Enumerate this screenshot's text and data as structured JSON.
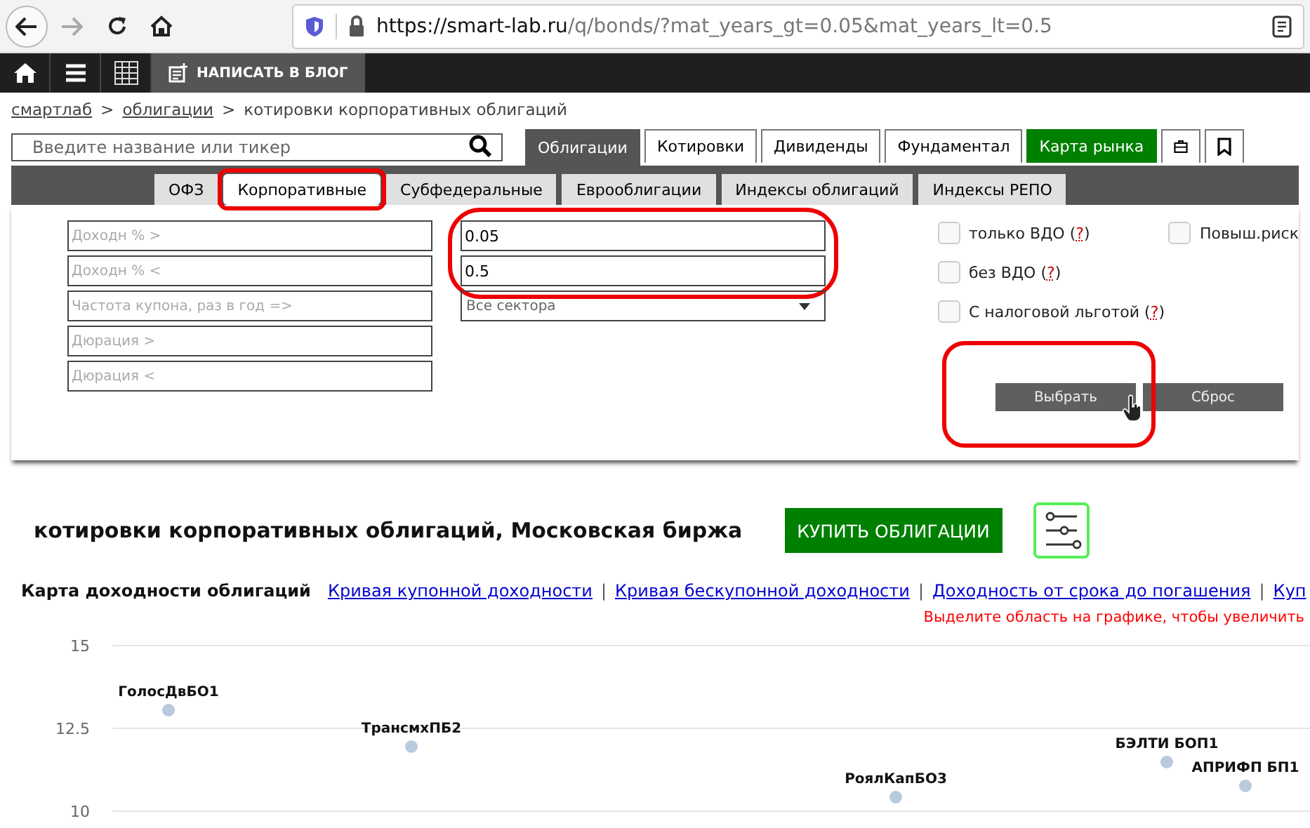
{
  "browser": {
    "url_host": "https://smart-lab.ru",
    "url_path": "/q/bonds/?mat_years_gt=0.05&mat_years_lt=0.5",
    "forward_disabled": true
  },
  "topnav": {
    "write_label": "НАПИСАТЬ В БЛОГ"
  },
  "breadcrumbs": {
    "links": [
      "смартлаб",
      "облигации"
    ],
    "separator": ">",
    "current": "котировки корпоративных облигаций"
  },
  "search": {
    "placeholder": "Введите название или тикер"
  },
  "tabs": [
    {
      "label": "Облигации",
      "kind": "text",
      "selected": true
    },
    {
      "label": "Котировки",
      "kind": "text",
      "selected": false
    },
    {
      "label": "Дивиденды",
      "kind": "text",
      "selected": false
    },
    {
      "label": "Фундаментал",
      "kind": "text",
      "selected": false
    },
    {
      "label": "Карта рынка",
      "kind": "accent",
      "selected": false
    },
    {
      "kind": "briefcase",
      "selected": false
    },
    {
      "kind": "bookmark",
      "selected": false
    }
  ],
  "subtabs": [
    {
      "label": "ОФЗ",
      "selected": false,
      "highlighted": false
    },
    {
      "label": "Корпоративные",
      "selected": true,
      "highlighted": true
    },
    {
      "label": "Субфедеральные",
      "selected": false,
      "highlighted": false
    },
    {
      "label": "Еврооблигации",
      "selected": false,
      "highlighted": false
    },
    {
      "label": "Индексы облигаций",
      "selected": false,
      "highlighted": false
    },
    {
      "label": "Индексы РЕПО",
      "selected": false,
      "highlighted": false
    }
  ],
  "filters": {
    "left_fields": [
      {
        "placeholder": "Доходн % >"
      },
      {
        "placeholder": "Доходн % <"
      },
      {
        "placeholder": "Частота купона, раз в год =>"
      },
      {
        "placeholder": "Дюрация >"
      },
      {
        "placeholder": "Дюрация <"
      }
    ],
    "maturity_fields": [
      {
        "value": "0.05"
      },
      {
        "value": "0.5"
      }
    ],
    "maturity_highlighted": true,
    "sector": {
      "value": "Все сектора"
    },
    "checkboxes": [
      {
        "label_before": "только ВДО (",
        "help": "?",
        "label_after": ")",
        "checked": false
      },
      {
        "label_before": "без ВДО (",
        "help": "?",
        "label_after": ")",
        "checked": false
      },
      {
        "label_before": "С налоговой льготой (",
        "help": "?",
        "label_after": ")",
        "checked": false
      }
    ],
    "extra_checkbox": {
      "label": "Повыш.риск",
      "checked": false
    },
    "select_button": {
      "label": "Выбрать",
      "highlighted": true
    },
    "reset_button": {
      "label": "Сброс"
    }
  },
  "heading": {
    "title": "котировки корпоративных облигаций, Московская биржа",
    "buy_button": "КУПИТЬ ОБЛИГАЦИИ"
  },
  "chart_links": {
    "current": "Карта доходности облигаций",
    "links": [
      "Кривая купонной доходности",
      "Кривая бескупонной доходности",
      "Доходность от срока до погашения",
      "Куп"
    ],
    "separator": "|"
  },
  "hint": "Выделите область на графике, чтобы увеличить",
  "yield_map": {
    "y_tick_labels": [
      "15",
      "12.5",
      "10"
    ],
    "point_labels": [
      "ГолосДвБО1",
      "ТрансмхПБ2",
      "РоялКапБО3",
      "БЭЛТИ БОП1",
      "АПРИФП БП1"
    ]
  }
}
